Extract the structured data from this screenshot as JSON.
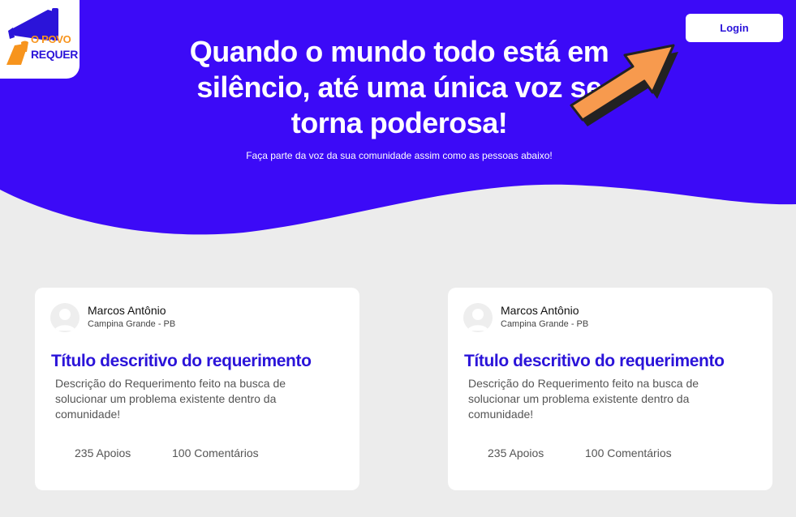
{
  "brand": {
    "logo_text_line1": "O POVO",
    "logo_text_line2": "REQUER",
    "colors": {
      "primary": "#2b14d9",
      "hero_blue": "#3c0af7",
      "logo_orange": "#f7941d",
      "arrow_orange": "#f79a4e",
      "background": "#ececec"
    }
  },
  "header": {
    "login_label": "Login"
  },
  "hero": {
    "headline": "Quando o mundo todo está em silêncio, até uma única voz se torna poderosa!",
    "subline": "Faça parte da voz da sua comunidade assim como as pessoas abaixo!"
  },
  "cards": [
    {
      "author_name": "Marcos Antônio",
      "author_location": "Campina Grande - PB",
      "title": "Título descritivo do requerimento",
      "description": "Descrição do Requerimento feito na busca de solucionar um problema existente dentro da comunidade!",
      "supports": "235 Apoios",
      "comments": "100 Comentários"
    },
    {
      "author_name": "Marcos Antônio",
      "author_location": "Campina Grande - PB",
      "title": "Título descritivo do requerimento",
      "description": "Descrição do Requerimento feito na busca de solucionar um problema existente dentro da comunidade!",
      "supports": "235 Apoios",
      "comments": "100 Comentários"
    }
  ]
}
